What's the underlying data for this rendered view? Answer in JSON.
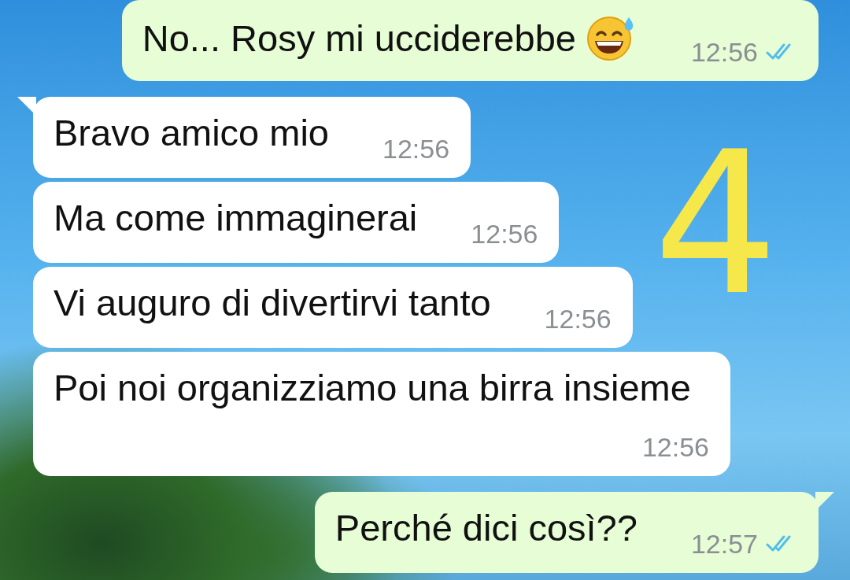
{
  "messages": [
    {
      "kind": "out",
      "text": "No... Rosy mi ucciderebbe",
      "emoji": true,
      "time": "12:56",
      "read": true,
      "tail": false
    },
    {
      "kind": "in",
      "text": "Bravo amico mio",
      "emoji": false,
      "time": "12:56",
      "tail": true
    },
    {
      "kind": "in",
      "text": "Ma come immaginerai",
      "emoji": false,
      "time": "12:56",
      "tail": false
    },
    {
      "kind": "in",
      "text": "Vi auguro di divertirvi tanto",
      "emoji": false,
      "time": "12:56",
      "tail": false
    },
    {
      "kind": "in",
      "text": "Poi noi organizziamo una birra insieme",
      "emoji": false,
      "time": "12:56",
      "tail": false
    },
    {
      "kind": "out",
      "text": "Perché dici così??",
      "emoji": false,
      "time": "12:57",
      "read": true,
      "tail": true
    }
  ],
  "annotation": {
    "text": "4"
  }
}
